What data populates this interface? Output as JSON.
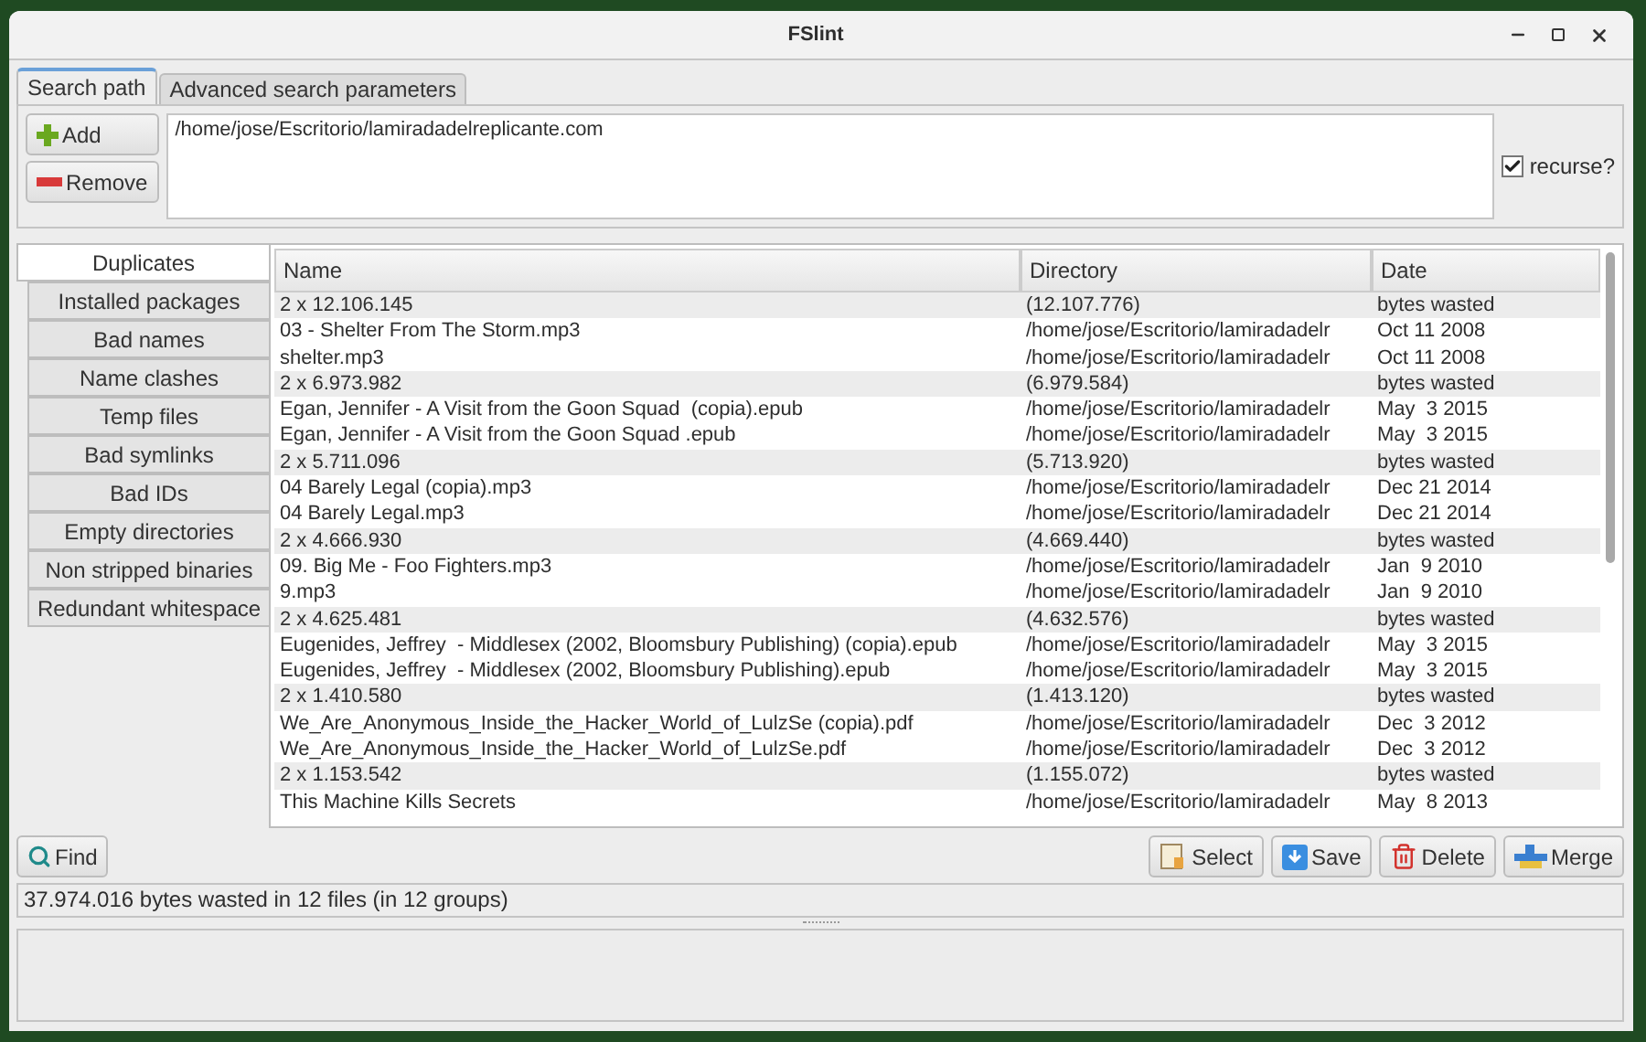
{
  "window": {
    "title": "FSlint"
  },
  "tabs": [
    {
      "label": "Search path",
      "selected": true
    },
    {
      "label": "Advanced search parameters",
      "selected": false
    }
  ],
  "path_panel": {
    "buttons": [
      {
        "kind": "add",
        "label": "Add"
      },
      {
        "kind": "remove",
        "label": "Remove"
      }
    ],
    "paths": [
      "/home/jose/Escritorio/lamiradadelreplicante.com"
    ],
    "recurse": {
      "label": "recurse?",
      "checked": true
    }
  },
  "sidebar": {
    "items": [
      {
        "label": "Duplicates",
        "selected": true
      },
      {
        "label": "Installed packages",
        "selected": false
      },
      {
        "label": "Bad names",
        "selected": false
      },
      {
        "label": "Name clashes",
        "selected": false
      },
      {
        "label": "Temp files",
        "selected": false
      },
      {
        "label": "Bad symlinks",
        "selected": false
      },
      {
        "label": "Bad IDs",
        "selected": false
      },
      {
        "label": "Empty directories",
        "selected": false
      },
      {
        "label": "Non stripped binaries",
        "selected": false
      },
      {
        "label": "Redundant whitespace",
        "selected": false
      }
    ]
  },
  "table": {
    "columns": [
      "Name",
      "Directory",
      "Date"
    ],
    "rows": [
      {
        "kind": "group",
        "cells": [
          "2 x 12.106.145",
          "(12.107.776)",
          "bytes wasted"
        ]
      },
      {
        "kind": "file",
        "cells": [
          "03 - Shelter From The Storm.mp3",
          "/home/jose/Escritorio/lamiradadelr",
          "Oct 11 2008"
        ]
      },
      {
        "kind": "file",
        "cells": [
          "shelter.mp3",
          "/home/jose/Escritorio/lamiradadelr",
          "Oct 11 2008"
        ]
      },
      {
        "kind": "group",
        "cells": [
          "2 x 6.973.982",
          "(6.979.584)",
          "bytes wasted"
        ]
      },
      {
        "kind": "file",
        "cells": [
          "Egan, Jennifer - A Visit from the Goon Squad  (copia).epub",
          "/home/jose/Escritorio/lamiradadelr",
          "May  3 2015"
        ]
      },
      {
        "kind": "file",
        "cells": [
          "Egan, Jennifer - A Visit from the Goon Squad .epub",
          "/home/jose/Escritorio/lamiradadelr",
          "May  3 2015"
        ]
      },
      {
        "kind": "group",
        "cells": [
          "2 x 5.711.096",
          "(5.713.920)",
          "bytes wasted"
        ]
      },
      {
        "kind": "file",
        "cells": [
          "04 Barely Legal (copia).mp3",
          "/home/jose/Escritorio/lamiradadelr",
          "Dec 21 2014"
        ]
      },
      {
        "kind": "file",
        "cells": [
          "04 Barely Legal.mp3",
          "/home/jose/Escritorio/lamiradadelr",
          "Dec 21 2014"
        ]
      },
      {
        "kind": "group",
        "cells": [
          "2 x 4.666.930",
          "(4.669.440)",
          "bytes wasted"
        ]
      },
      {
        "kind": "file",
        "cells": [
          "09. Big Me - Foo Fighters.mp3",
          "/home/jose/Escritorio/lamiradadelr",
          "Jan  9 2010"
        ]
      },
      {
        "kind": "file",
        "cells": [
          "9.mp3",
          "/home/jose/Escritorio/lamiradadelr",
          "Jan  9 2010"
        ]
      },
      {
        "kind": "group",
        "cells": [
          "2 x 4.625.481",
          "(4.632.576)",
          "bytes wasted"
        ]
      },
      {
        "kind": "file",
        "cells": [
          "Eugenides, Jeffrey  - Middlesex (2002, Bloomsbury Publishing) (copia).epub",
          "/home/jose/Escritorio/lamiradadelr",
          "May  3 2015"
        ]
      },
      {
        "kind": "file",
        "cells": [
          "Eugenides, Jeffrey  - Middlesex (2002, Bloomsbury Publishing).epub",
          "/home/jose/Escritorio/lamiradadelr",
          "May  3 2015"
        ]
      },
      {
        "kind": "group",
        "cells": [
          "2 x 1.410.580",
          "(1.413.120)",
          "bytes wasted"
        ]
      },
      {
        "kind": "file",
        "cells": [
          "We_Are_Anonymous_Inside_the_Hacker_World_of_LulzSe (copia).pdf",
          "/home/jose/Escritorio/lamiradadelr",
          "Dec  3 2012"
        ]
      },
      {
        "kind": "file",
        "cells": [
          "We_Are_Anonymous_Inside_the_Hacker_World_of_LulzSe.pdf",
          "/home/jose/Escritorio/lamiradadelr",
          "Dec  3 2012"
        ]
      },
      {
        "kind": "group",
        "cells": [
          "2 x 1.153.542",
          "(1.155.072)",
          "bytes wasted"
        ]
      },
      {
        "kind": "file",
        "cells": [
          "This Machine Kills Secrets",
          "/home/jose/Escritorio/lamiradadelr",
          "May  8 2013"
        ]
      }
    ]
  },
  "find_button": {
    "label": "Find"
  },
  "actions": [
    {
      "kind": "select",
      "label": "Select"
    },
    {
      "kind": "save",
      "label": "Save"
    },
    {
      "kind": "delete",
      "label": "Delete"
    },
    {
      "kind": "merge",
      "label": "Merge"
    }
  ],
  "status_bar": "37.974.016 bytes wasted in 12 files (in 12 groups)"
}
